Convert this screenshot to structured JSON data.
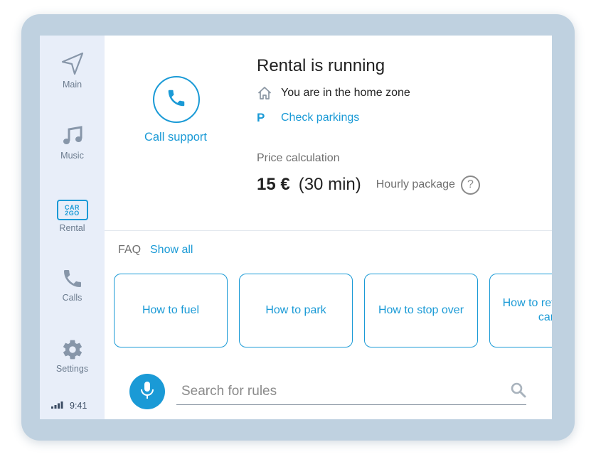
{
  "sidebar": {
    "items": [
      {
        "label": "Main",
        "icon": "navigation-arrow-icon"
      },
      {
        "label": "Music",
        "icon": "music-note-icon"
      },
      {
        "label": "Rental",
        "icon": "car2go-logo-icon",
        "logo_text": "CAR2GO"
      },
      {
        "label": "Calls",
        "icon": "phone-icon"
      },
      {
        "label": "Settings",
        "icon": "gear-icon"
      }
    ],
    "status_time": "9:41"
  },
  "call": {
    "label": "Call support"
  },
  "rental": {
    "title": "Rental is running",
    "home_zone": "You are in the home zone",
    "parkings_glyph": "P",
    "parkings_link": "Check parkings",
    "price_label": "Price calculation",
    "price_amount": "15 €",
    "price_duration": "(30 min)",
    "package": "Hourly package",
    "help_glyph": "?"
  },
  "faq": {
    "label": "FAQ",
    "show_all": "Show all",
    "cards": [
      {
        "label": "How to fuel"
      },
      {
        "label": "How to park"
      },
      {
        "label": "How to stop over"
      },
      {
        "label": "How to return the car"
      }
    ]
  },
  "search": {
    "placeholder": "Search for rules",
    "value": ""
  },
  "colors": {
    "accent": "#1a9ad6",
    "sidebar_bg": "#e8eef9",
    "frame": "#bfd1e0"
  }
}
